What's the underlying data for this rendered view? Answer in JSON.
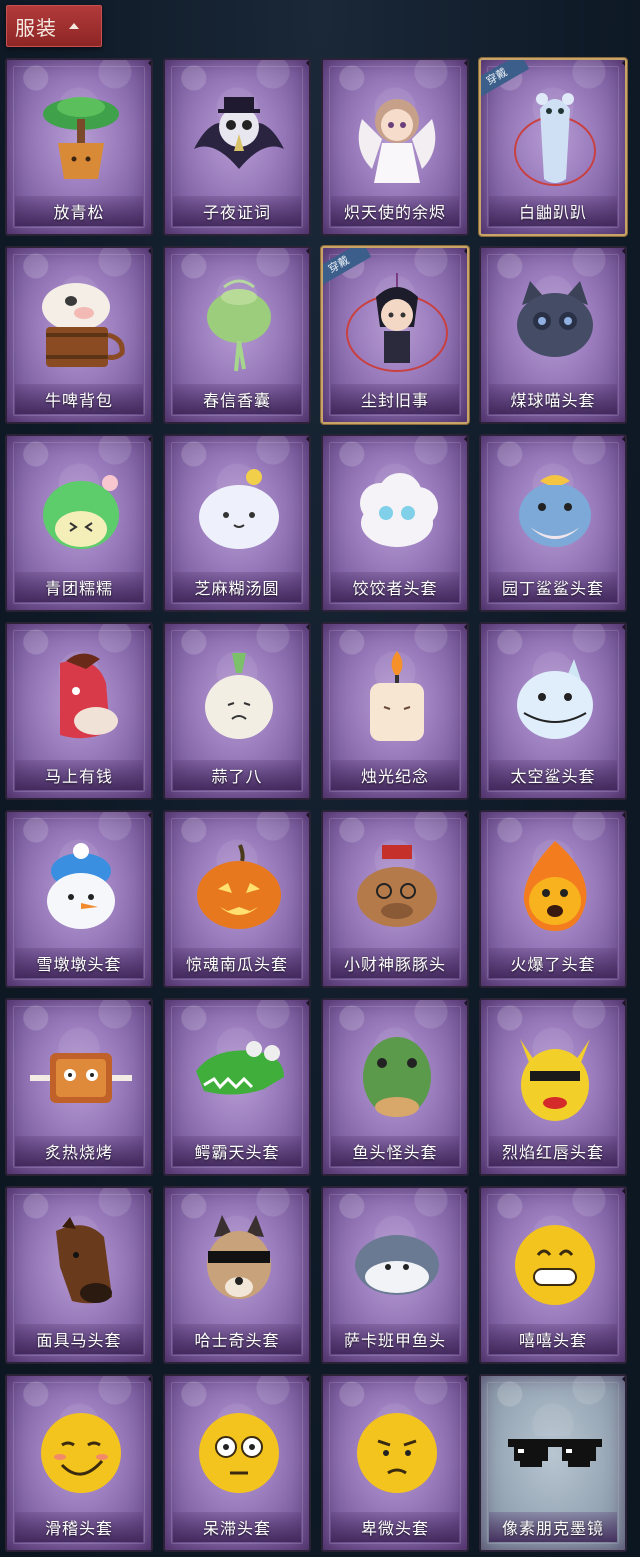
{
  "header": {
    "label": "服装",
    "chevron_icon": "chevron-up-icon",
    "bg_color": "#a83030"
  },
  "badge_label": "穿戴",
  "items": [
    {
      "name": "放青松",
      "icon": "bonsai-pine-icon",
      "equipped": false,
      "style": "purple"
    },
    {
      "name": "子夜证词",
      "icon": "crow-plague-doctor-icon",
      "equipped": false,
      "style": "purple"
    },
    {
      "name": "炽天使的余烬",
      "icon": "angel-girl-icon",
      "equipped": false,
      "style": "purple"
    },
    {
      "name": "白鼬趴趴",
      "icon": "white-ferret-icon",
      "equipped": true,
      "style": "purple"
    },
    {
      "name": "牛啤背包",
      "icon": "cow-beer-mug-icon",
      "equipped": false,
      "style": "purple"
    },
    {
      "name": "春信香囊",
      "icon": "green-sachet-icon",
      "equipped": false,
      "style": "purple"
    },
    {
      "name": "尘封旧事",
      "icon": "chibi-prince-charm-icon",
      "equipped": true,
      "style": "purple"
    },
    {
      "name": "煤球喵头套",
      "icon": "black-cat-head-icon",
      "equipped": false,
      "style": "purple"
    },
    {
      "name": "青团糯糯",
      "icon": "green-rice-ball-icon",
      "equipped": false,
      "style": "purple"
    },
    {
      "name": "芝麻糊汤圆",
      "icon": "white-dumpling-flower-icon",
      "equipped": false,
      "style": "purple"
    },
    {
      "name": "饺饺者头套",
      "icon": "cloud-dumpling-head-icon",
      "equipped": false,
      "style": "purple"
    },
    {
      "name": "园丁鲨鲨头套",
      "icon": "gardener-shark-icon",
      "equipped": false,
      "style": "purple"
    },
    {
      "name": "马上有钱",
      "icon": "red-horse-head-icon",
      "equipped": false,
      "style": "purple"
    },
    {
      "name": "蒜了八",
      "icon": "garlic-head-icon",
      "equipped": false,
      "style": "purple"
    },
    {
      "name": "烛光纪念",
      "icon": "candle-head-icon",
      "equipped": false,
      "style": "purple"
    },
    {
      "name": "太空鲨头套",
      "icon": "space-shark-head-icon",
      "equipped": false,
      "style": "purple"
    },
    {
      "name": "雪墩墩头套",
      "icon": "snowman-reindeer-icon",
      "equipped": false,
      "style": "purple"
    },
    {
      "name": "惊魂南瓜头套",
      "icon": "pumpkin-head-icon",
      "equipped": false,
      "style": "purple"
    },
    {
      "name": "小财神豚豚头",
      "icon": "capybara-fortune-icon",
      "equipped": false,
      "style": "purple"
    },
    {
      "name": "火爆了头套",
      "icon": "fire-head-icon",
      "equipped": false,
      "style": "purple"
    },
    {
      "name": "炙热烧烤",
      "icon": "bbq-meat-icon",
      "equipped": false,
      "style": "purple"
    },
    {
      "name": "鳄霸天头套",
      "icon": "crocodile-head-icon",
      "equipped": false,
      "style": "purple"
    },
    {
      "name": "鱼头怪头套",
      "icon": "fish-head-mask-icon",
      "equipped": false,
      "style": "purple"
    },
    {
      "name": "烈焰红唇头套",
      "icon": "pikachu-lips-icon",
      "equipped": false,
      "style": "purple"
    },
    {
      "name": "面具马头套",
      "icon": "horse-mask-icon",
      "equipped": false,
      "style": "purple"
    },
    {
      "name": "哈士奇头套",
      "icon": "husky-sunglasses-icon",
      "equipped": false,
      "style": "purple"
    },
    {
      "name": "萨卡班甲鱼头",
      "icon": "sacabambaspis-icon",
      "equipped": false,
      "style": "purple"
    },
    {
      "name": "嘻嘻头套",
      "icon": "grin-emoji-icon",
      "equipped": false,
      "style": "purple"
    },
    {
      "name": "滑稽头套",
      "icon": "smirk-emoji-icon",
      "equipped": false,
      "style": "purple"
    },
    {
      "name": "呆滞头套",
      "icon": "stare-emoji-icon",
      "equipped": false,
      "style": "purple"
    },
    {
      "name": "卑微头套",
      "icon": "humble-emoji-icon",
      "equipped": false,
      "style": "purple"
    },
    {
      "name": "像素朋克墨镜",
      "icon": "pixel-sunglasses-icon",
      "equipped": false,
      "style": "gray"
    }
  ]
}
